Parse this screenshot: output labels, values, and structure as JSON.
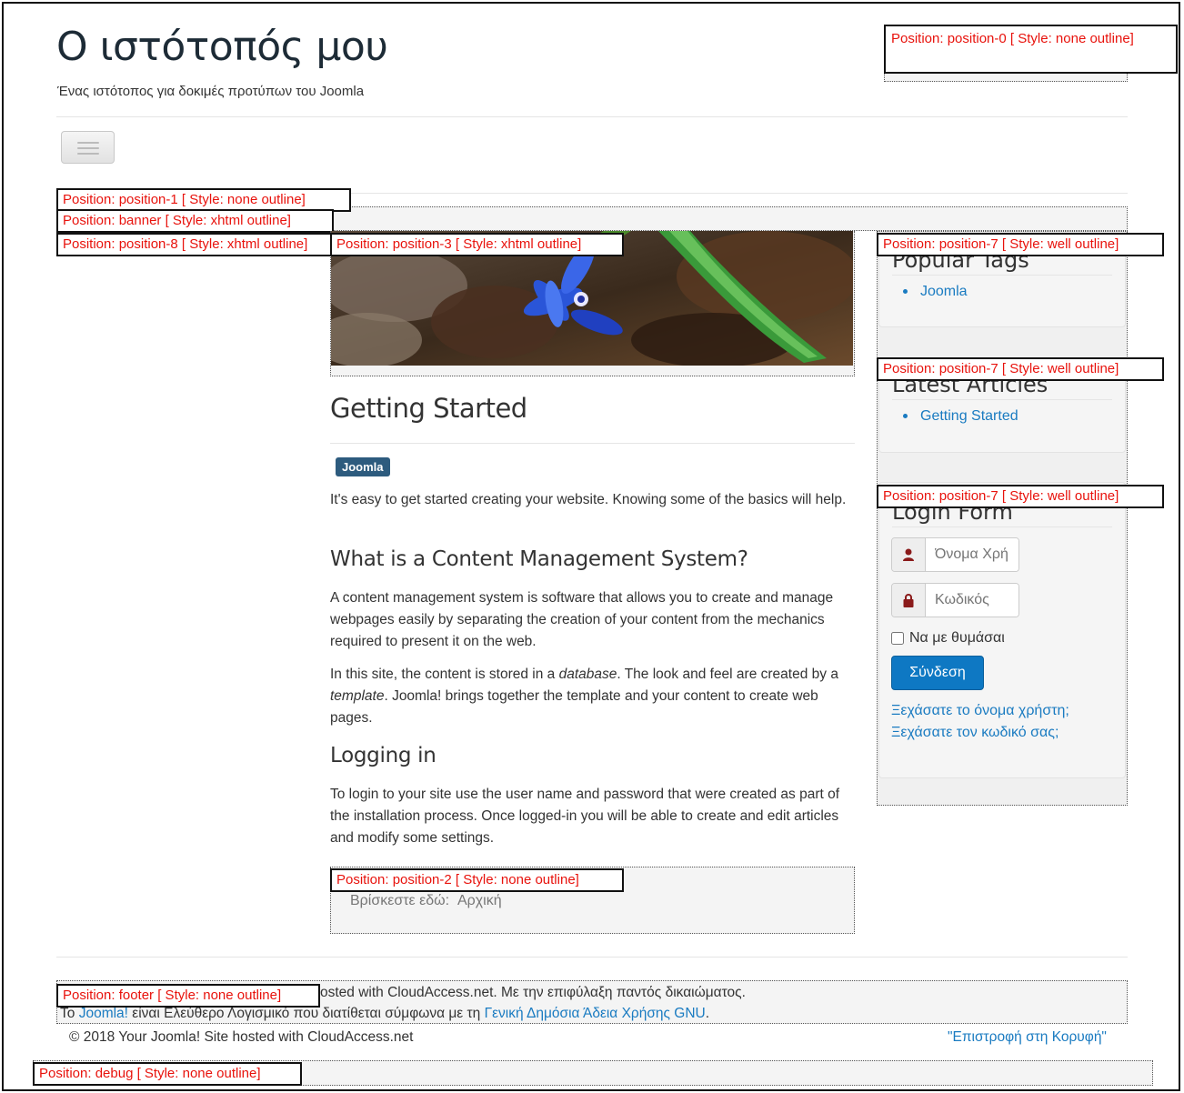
{
  "site": {
    "title": "Ο ιστότοπός μου",
    "description": "Ένας ιστότοπος για δοκιμές προτύπων του Joomla"
  },
  "positions": {
    "p0": "Position: position-0 [ Style: none outline]",
    "p1": "Position: position-1 [ Style: none outline]",
    "banner": "Position: banner [ Style: xhtml outline]",
    "p8": "Position: position-8 [ Style: xhtml outline]",
    "p3": "Position: position-3 [ Style: xhtml outline]",
    "p7a": "Position: position-7 [ Style: well outline]",
    "p7b": "Position: position-7 [ Style: well outline]",
    "p7c": "Position: position-7 [ Style: well outline]",
    "p2": "Position: position-2 [ Style: none outline]",
    "footer": "Position: footer [ Style: none outline]",
    "debug": "Position: debug [ Style: none outline]"
  },
  "article": {
    "title": "Getting Started",
    "tag": "Joomla",
    "intro": "It's easy to get started creating your website. Knowing some of the basics will help.",
    "h_cms": "What is a Content Management System?",
    "p_cms": "A content management system is software that allows you to create and manage webpages easily by separating the creation of your content from the mechanics required to present it on the web.",
    "p_db_1": "In this site, the content is stored in a ",
    "p_db_em1": "database",
    "p_db_2": ". The look and feel are created by a ",
    "p_db_em2": "template",
    "p_db_3": ". Joomla! brings together the template and your content to create web pages.",
    "h_login": "Logging in",
    "p_login": "To login to your site use the user name and password that were created as part of the installation process. Once logged-in you will be able to create and edit articles and modify some settings."
  },
  "breadcrumb": {
    "label": "Βρίσκεστε εδώ:",
    "home": "Αρχική"
  },
  "sidebar": {
    "popular_tags_title": "Popular Tags",
    "popular_tags": [
      "Joomla"
    ],
    "latest_title": "Latest Articles",
    "latest": [
      "Getting Started"
    ],
    "login_title": "Login Form",
    "username_placeholder": "Όνομα Χρή",
    "password_placeholder": "Κωδικός",
    "remember_label": "Να με θυμάσαι",
    "login_button": "Σύνδεση",
    "forgot_username": "Ξεχάσατε το όνομα χρήστη;",
    "forgot_password": "Ξεχάσατε τον κωδικό σας;"
  },
  "footer": {
    "line1_rest": "osted with CloudAccess.net. Με την επιφύλαξη παντός δικαιώματος.",
    "line2_pre": "Το ",
    "line2_link1": "Joomla!",
    "line2_mid": " είναι Ελεύθερο Λογισμικό που διατίθεται σύμφωνα με τη ",
    "line2_link2": "Γενική Δημόσια Άδεια Χρήσης GNU",
    "line2_post": ".",
    "copyright": "© 2018 Your Joomla! Site hosted with CloudAccess.net",
    "back_to_top": "\"Επιστροφή στη Κορυφή\""
  },
  "colors": {
    "accent": "#1a7bc1",
    "label_red": "#e8120c",
    "tag_bg": "#2d5b7e",
    "button": "#0e78c3"
  },
  "icons": {
    "menu": "hamburger-icon",
    "user": "user-icon",
    "lock": "lock-icon"
  }
}
